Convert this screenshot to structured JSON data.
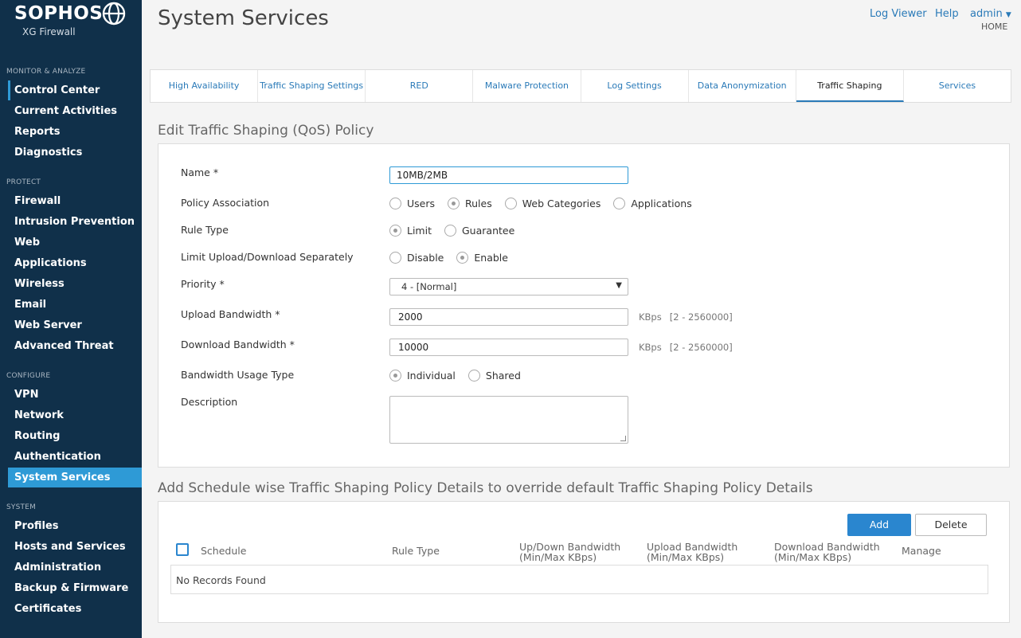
{
  "brand": {
    "name": "SOPHOS",
    "product": "XG Firewall"
  },
  "sidebar": {
    "sections": [
      {
        "title": "MONITOR & ANALYZE",
        "items": [
          "Control Center",
          "Current Activities",
          "Reports",
          "Diagnostics"
        ]
      },
      {
        "title": "PROTECT",
        "items": [
          "Firewall",
          "Intrusion Prevention",
          "Web",
          "Applications",
          "Wireless",
          "Email",
          "Web Server",
          "Advanced Threat"
        ]
      },
      {
        "title": "CONFIGURE",
        "items": [
          "VPN",
          "Network",
          "Routing",
          "Authentication",
          "System Services"
        ]
      },
      {
        "title": "SYSTEM",
        "items": [
          "Profiles",
          "Hosts and Services",
          "Administration",
          "Backup & Firmware",
          "Certificates"
        ]
      }
    ],
    "active": "System Services"
  },
  "header": {
    "title": "System Services",
    "log_viewer": "Log Viewer",
    "help": "Help",
    "user": "admin",
    "home": "HOME"
  },
  "tabs": [
    "High Availability",
    "Traffic Shaping Settings",
    "RED",
    "Malware Protection",
    "Log Settings",
    "Data Anonymization",
    "Traffic Shaping",
    "Services"
  ],
  "active_tab": "Traffic Shaping",
  "form": {
    "title": "Edit Traffic Shaping (QoS) Policy",
    "name_label": "Name *",
    "name_value": "10MB/2MB",
    "assoc_label": "Policy Association",
    "assoc_options": [
      "Users",
      "Rules",
      "Web Categories",
      "Applications"
    ],
    "assoc_selected": "Rules",
    "rule_type_label": "Rule Type",
    "rule_type_options": [
      "Limit",
      "Guarantee"
    ],
    "rule_type_selected": "Limit",
    "separate_label": "Limit Upload/Download Separately",
    "separate_options": [
      "Disable",
      "Enable"
    ],
    "separate_selected": "Enable",
    "priority_label": "Priority *",
    "priority_value": "4 - [Normal]",
    "upload_label": "Upload Bandwidth *",
    "upload_value": "2000",
    "download_label": "Download Bandwidth *",
    "download_value": "10000",
    "unit": "KBps",
    "range": "[2 - 2560000]",
    "usage_label": "Bandwidth Usage Type",
    "usage_options": [
      "Individual",
      "Shared"
    ],
    "usage_selected": "Individual",
    "description_label": "Description",
    "description_value": ""
  },
  "schedule": {
    "title": "Add Schedule wise Traffic Shaping Policy Details to override default Traffic Shaping Policy Details",
    "add": "Add",
    "delete": "Delete",
    "columns": {
      "schedule": "Schedule",
      "rule_type": "Rule Type",
      "updown_1": "Up/Down Bandwidth",
      "updown_2": "(Min/Max KBps)",
      "upload_1": "Upload Bandwidth",
      "upload_2": "(Min/Max KBps)",
      "download_1": "Download Bandwidth",
      "download_2": "(Min/Max KBps)",
      "manage": "Manage"
    },
    "empty": "No Records Found"
  }
}
